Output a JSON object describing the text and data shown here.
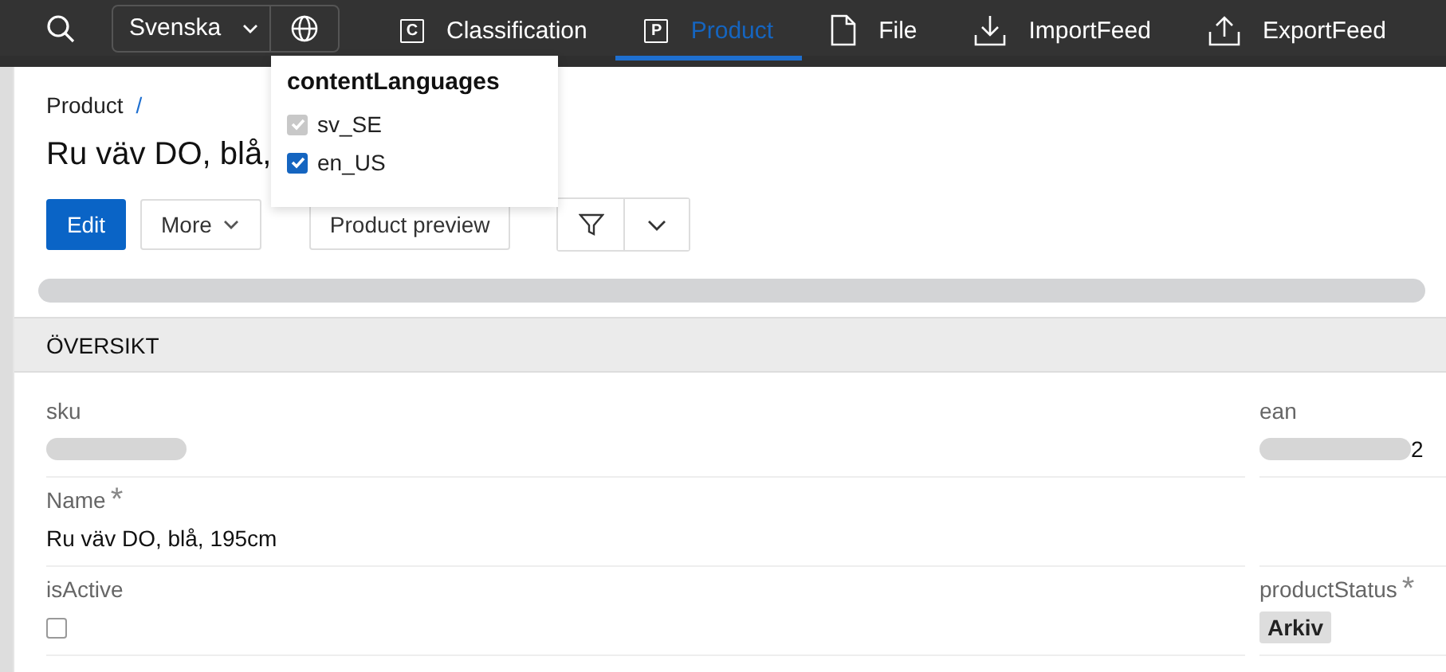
{
  "top_bar": {
    "language_select": {
      "value": "Svenska"
    },
    "nav": [
      {
        "label": "Classification",
        "kind": "letter",
        "icon_text": "C",
        "selected": false
      },
      {
        "label": "Product",
        "kind": "letter",
        "icon_text": "P",
        "selected": true
      },
      {
        "label": "File",
        "kind": "file",
        "selected": false
      },
      {
        "label": "ImportFeed",
        "kind": "import",
        "selected": false
      },
      {
        "label": "ExportFeed",
        "kind": "export",
        "selected": false
      }
    ]
  },
  "languages_popover": {
    "title": "contentLanguages",
    "options": [
      {
        "label": "sv_SE",
        "checked": true,
        "disabled": true
      },
      {
        "label": "en_US",
        "checked": true,
        "disabled": false
      }
    ]
  },
  "breadcrumb": [
    {
      "label": "Product",
      "separator": "/"
    }
  ],
  "title": "Ru väv DO, blå,",
  "actions": [
    {
      "label": "Edit",
      "kind": "primary"
    },
    {
      "label": "More",
      "kind": "menu"
    },
    {
      "label": "Product preview",
      "kind": "plain"
    }
  ],
  "section": {
    "title": "ÖVERSIKT"
  },
  "fields": [
    {
      "label": "sku",
      "kind": "redacted"
    },
    {
      "label": "ean",
      "kind": "redacted",
      "value": "2"
    },
    {
      "label": "Name",
      "required_mark": "*",
      "kind": "text",
      "value": "Ru väv DO, blå, 195cm"
    },
    {
      "kind": "empty"
    },
    {
      "label": "isActive",
      "kind": "checkbox",
      "checked": false
    },
    {
      "label": "productStatus",
      "required_mark": "*",
      "kind": "tag",
      "value": "Arkiv"
    }
  ]
}
